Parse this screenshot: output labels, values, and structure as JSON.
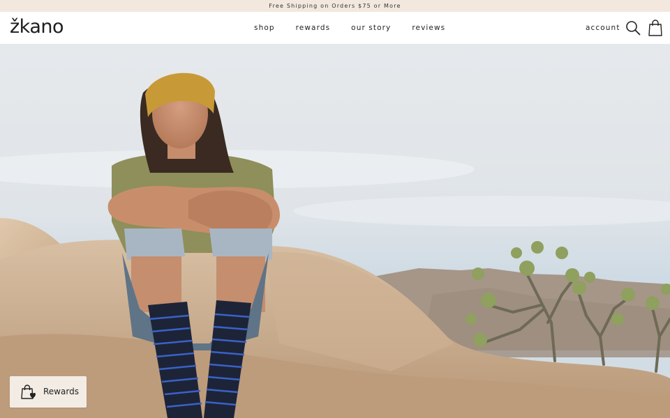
{
  "announcement": {
    "text": "Free Shipping on Orders $75 or More"
  },
  "header": {
    "logo": "žkano",
    "nav": [
      {
        "label": "shop"
      },
      {
        "label": "rewards"
      },
      {
        "label": "our story"
      },
      {
        "label": "reviews"
      }
    ],
    "account_label": "account",
    "icons": {
      "search": "search-icon",
      "cart": "shopping-bag-icon"
    }
  },
  "hero": {
    "image": "man-in-yellow-headband-sitting-on-desert-rocks-wearing-striped-socks"
  },
  "rewards_widget": {
    "label": "Rewards",
    "icon": "shopping-bag-heart-icon"
  },
  "colors": {
    "announcement_bg": "#f2e8de",
    "rewards_bg": "#f3ece4",
    "text": "#222222"
  }
}
